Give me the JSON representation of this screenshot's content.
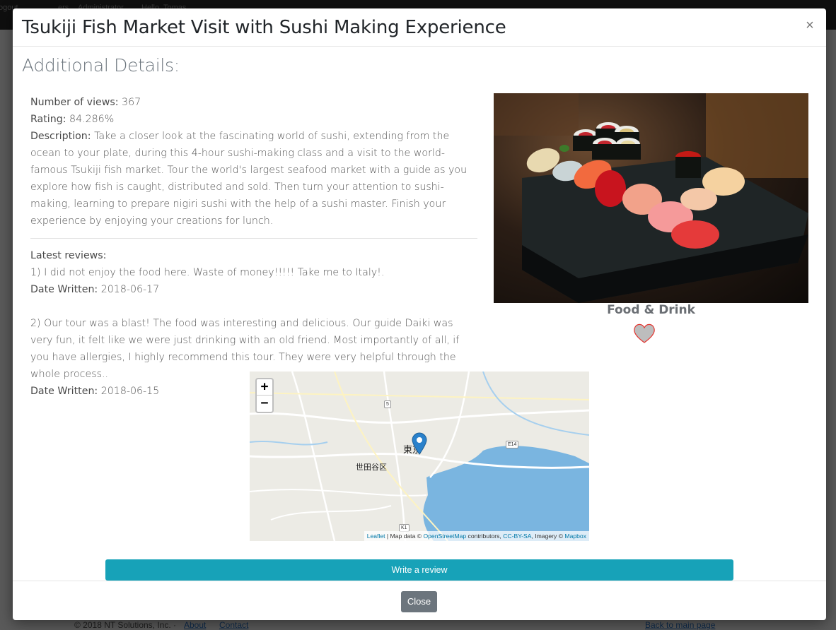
{
  "background": {
    "topbar_items": [
      "ogout",
      "ers",
      "Administrator",
      "Hello, Tomas"
    ],
    "footer": {
      "copyright": "© 2018 NT Solutions, Inc. ·",
      "links": [
        "About",
        "Contact"
      ],
      "back_link": "Back to main page"
    }
  },
  "modal": {
    "title": "Tsukiji Fish Market Visit with Sushi Making Experience",
    "close_symbol": "×",
    "section_heading": "Additional Details:",
    "details": {
      "views_label": "Number of views:",
      "views_value": "367",
      "rating_label": "Rating:",
      "rating_value": "84.286%",
      "description_label": "Description:",
      "description_value": "Take a closer look at the fascinating world of sushi, extending from the ocean to your plate, during this 4-hour sushi-making class and a visit to the world-famous Tsukiji fish market. Tour the world's largest seafood market with a guide as you explore how fish is caught, distributed and sold. Then turn your attention to sushi-making, learning to prepare nigiri sushi with the help of a sushi master. Finish your experience by enjoying your creations for lunch."
    },
    "reviews": {
      "heading": "Latest reviews:",
      "date_label": "Date Written:",
      "items": [
        {
          "text": "1) I did not enjoy the food here. Waste of money!!!!! Take me to Italy!.",
          "date": "2018-06-17"
        },
        {
          "text": "2) Our tour was a blast! The food was interesting and delicious. Our guide Daiki was very fun, it felt like we were just drinking with an old friend. Most importantly of all, if you have allergies, I highly recommend this tour. They were very helpful through the whole process..",
          "date": "2018-06-15"
        }
      ]
    },
    "category": "Food & Drink",
    "map": {
      "zoom_in": "+",
      "zoom_out": "−",
      "labels": {
        "city": "東京",
        "ward": "世田谷区"
      },
      "shields": [
        "5",
        "E14",
        "K1"
      ],
      "attribution": {
        "leaflet": "Leaflet",
        "sep1": " | Map data © ",
        "osm": "OpenStreetMap",
        "contrib": " contributors, ",
        "license": "CC-BY-SA",
        "imagery": ", Imagery © ",
        "mapbox": "Mapbox"
      },
      "water_color": "#7ab5e0",
      "marker_color": "#2a81cb"
    },
    "write_review_label": "Write a review",
    "close_button_label": "Close"
  },
  "colors": {
    "write_review_bg": "#17a2b8",
    "close_button_bg": "#6c757d"
  }
}
